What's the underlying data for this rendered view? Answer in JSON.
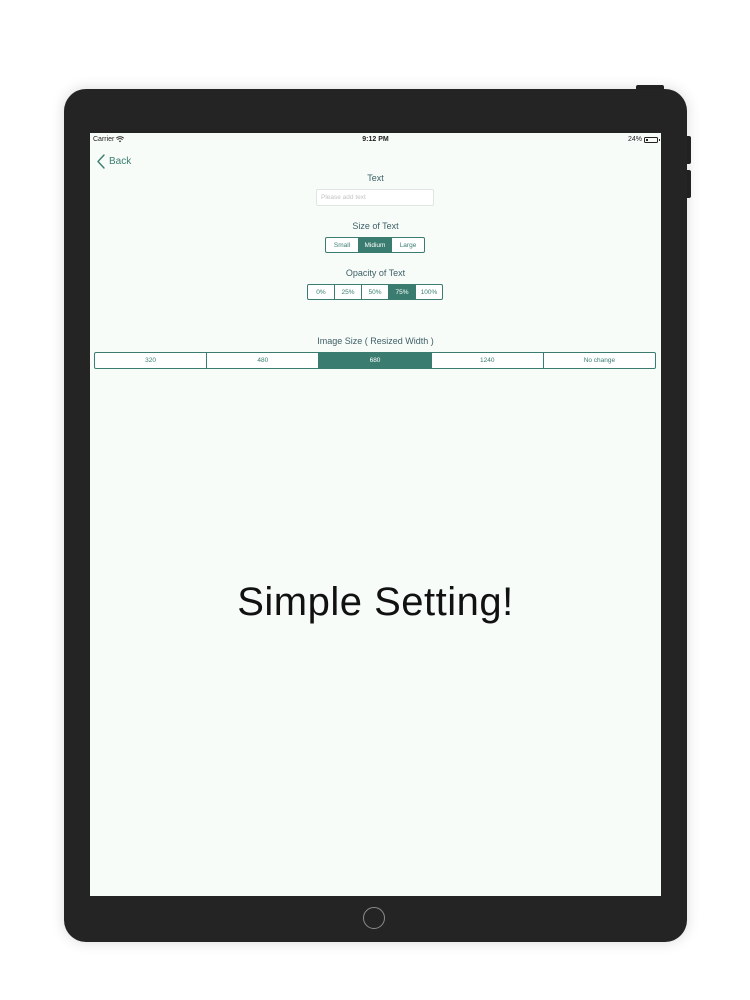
{
  "status_bar": {
    "carrier": "Carrier",
    "time": "9:12 PM",
    "battery_percent": "24%",
    "battery_level": 0.24,
    "wifi_icon": "wifi-icon",
    "battery_icon": "battery-icon"
  },
  "nav": {
    "back_label": "Back",
    "back_icon": "chevron-left-icon"
  },
  "text_section": {
    "label": "Text",
    "placeholder": "Please add text",
    "value": ""
  },
  "size_section": {
    "label": "Size of Text",
    "options": [
      "Small",
      "Midium",
      "Large"
    ],
    "selected": "Midium"
  },
  "opacity_section": {
    "label": "Opacity of Text",
    "options": [
      "0%",
      "25%",
      "50%",
      "75%",
      "100%"
    ],
    "selected": "75%"
  },
  "image_size_section": {
    "label": "Image Size ( Resized Width )",
    "options": [
      "320",
      "480",
      "680",
      "1240",
      "No change"
    ],
    "selected": "680"
  },
  "hero_text": "Simple Setting!",
  "colors": {
    "accent": "#3a7d70",
    "screen_background": "#f8fcf9",
    "device_frame": "#242424"
  }
}
